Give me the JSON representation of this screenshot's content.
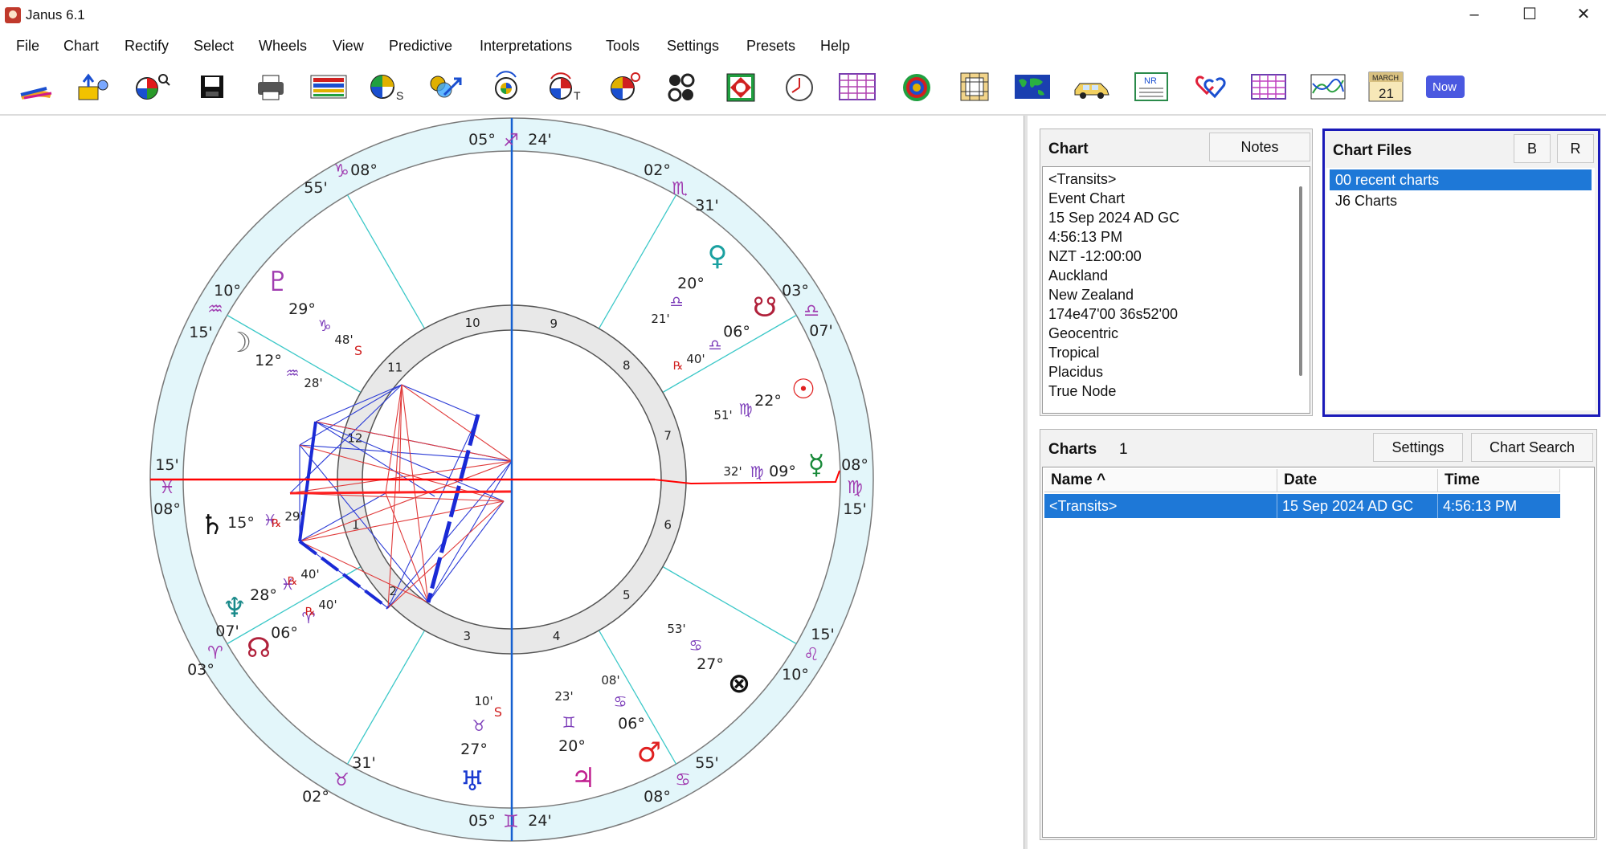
{
  "window": {
    "title": "Janus 6.1",
    "minimize": "–",
    "maximize": "☐",
    "close": "✕"
  },
  "menu": [
    "File",
    "Chart",
    "Rectify",
    "Select",
    "Wheels",
    "View",
    "Predictive",
    "Interpretations",
    "Tools",
    "Settings",
    "Presets",
    "Help"
  ],
  "toolbar": {
    "now_label": "Now",
    "calendar_month": "MARCH",
    "calendar_day": "21",
    "nr_label": "NR",
    "s_label": "S",
    "t_label": "T"
  },
  "chart_info": {
    "title": "Chart",
    "notes_button": "Notes",
    "lines": [
      "<Transits>",
      "Event Chart",
      "15 Sep 2024 AD GC",
      "4:56:13 PM",
      "NZT -12:00:00",
      "Auckland",
      "New Zealand",
      "174e47'00 36s52'00",
      "Geocentric",
      "Tropical",
      "Placidus",
      "True Node"
    ]
  },
  "chart_files": {
    "title": "Chart Files",
    "b_button": "B",
    "r_button": "R",
    "items": [
      "00 recent charts",
      "J6 Charts"
    ]
  },
  "charts_list": {
    "title": "Charts",
    "count": "1",
    "settings_button": "Settings",
    "search_button": "Chart Search",
    "columns": [
      "Name ^",
      "Date",
      "Time"
    ],
    "rows": [
      {
        "name": "<Transits>",
        "date": "15 Sep 2024 AD GC",
        "time": "4:56:13 PM"
      }
    ]
  },
  "wheel": {
    "cusps": [
      {
        "deg": "05°",
        "sign": "♐",
        "min": "24'"
      },
      {
        "deg": "02°",
        "sign": "♏",
        "min": "31'"
      },
      {
        "deg": "03°",
        "sign": "♎",
        "min": "07'"
      },
      {
        "deg": "08°",
        "sign": "♍",
        "min": "15'"
      },
      {
        "deg": "15'",
        "sign": "♌",
        "min": "10°"
      },
      {
        "deg": "55'",
        "sign": "♋",
        "min": "08°"
      },
      {
        "deg": "05°",
        "sign": "♊",
        "min": "24'"
      },
      {
        "deg": "02°",
        "sign": "♉",
        "min": "31'"
      },
      {
        "deg": "03°",
        "sign": "♈",
        "min": "07'"
      },
      {
        "deg": "08°",
        "sign": "♓",
        "min": "15'"
      },
      {
        "deg": "15'",
        "sign": "♒",
        "min": "10°"
      },
      {
        "deg": "55'",
        "sign": "♑",
        "min": "08°"
      }
    ],
    "house_numbers": [
      "1",
      "2",
      "3",
      "4",
      "5",
      "6",
      "7",
      "8",
      "9",
      "10",
      "11",
      "12"
    ],
    "planets": [
      {
        "glyph": "♀",
        "deg": "20°",
        "sign": "♎",
        "min": "21'"
      },
      {
        "glyph": "☋",
        "deg": "06°",
        "sign": "♎",
        "min": "40'",
        "retro": "℞"
      },
      {
        "glyph": "☉",
        "deg": "22°",
        "sign": "♍",
        "min": "51'"
      },
      {
        "glyph": "☿",
        "deg": "09°",
        "sign": "♍",
        "min": "32'"
      },
      {
        "glyph": "⊗",
        "deg": "27°",
        "sign": "♋",
        "min": "53'"
      },
      {
        "glyph": "♂",
        "deg": "06°",
        "sign": "♋",
        "min": "08'"
      },
      {
        "glyph": "♃",
        "deg": "20°",
        "sign": "♊",
        "min": "23'"
      },
      {
        "glyph": "♅",
        "deg": "27°",
        "sign": "♉",
        "min": "10'",
        "station": "S"
      },
      {
        "glyph": "☊",
        "deg": "06°",
        "sign": "♈",
        "min": "40'",
        "retro": "℞"
      },
      {
        "glyph": "♆",
        "deg": "28°",
        "sign": "♓",
        "min": "40'",
        "retro": "℞"
      },
      {
        "glyph": "♄",
        "deg": "15°",
        "sign": "♓",
        "min": "29'",
        "retro": "℞"
      },
      {
        "glyph": "☽",
        "deg": "12°",
        "sign": "♒",
        "min": "28'"
      },
      {
        "glyph": "♇",
        "deg": "29°",
        "sign": "♑",
        "min": "48'",
        "station": "S"
      }
    ]
  },
  "colors": {
    "selection": "#1e78d7",
    "wheel_ring": "#e3f6fa",
    "ascendant": "#ff0000",
    "midheaven": "#1560d0",
    "cusp_line": "#3cc8c8"
  }
}
